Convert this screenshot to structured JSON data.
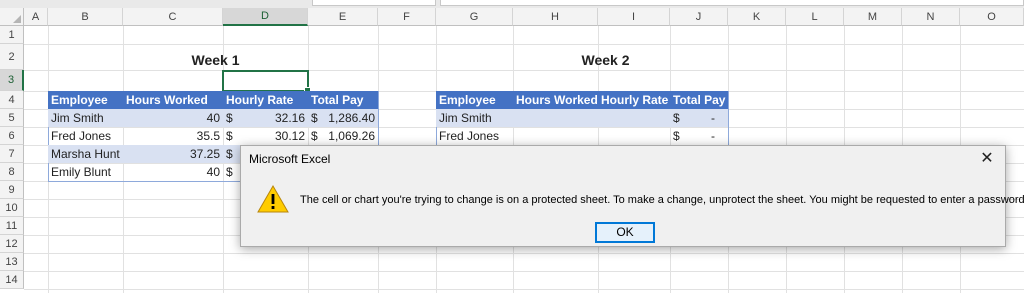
{
  "columns": [
    "A",
    "B",
    "C",
    "D",
    "E",
    "F",
    "G",
    "H",
    "I",
    "J",
    "K",
    "L",
    "M",
    "N",
    "O"
  ],
  "rows": [
    "1",
    "2",
    "3",
    "4",
    "5",
    "6",
    "7",
    "8",
    "9",
    "10",
    "11",
    "12",
    "13",
    "14"
  ],
  "selected_cell": "D3",
  "week1": {
    "title": "Week 1",
    "headers": [
      "Employee",
      "Hours Worked",
      "Hourly Rate",
      "Total Pay"
    ],
    "rows": [
      {
        "employee": "Jim Smith",
        "hours": "40",
        "rate_cur": "$",
        "rate": "32.16",
        "pay_cur": "$",
        "pay": "1,286.40"
      },
      {
        "employee": "Fred Jones",
        "hours": "35.5",
        "rate_cur": "$",
        "rate": "30.12",
        "pay_cur": "$",
        "pay": "1,069.26"
      },
      {
        "employee": "Marsha Hunt",
        "hours": "37.25",
        "rate_cur": "$",
        "rate": "",
        "pay_cur": "",
        "pay": ""
      },
      {
        "employee": "Emily Blunt",
        "hours": "40",
        "rate_cur": "$",
        "rate": "",
        "pay_cur": "",
        "pay": ""
      }
    ]
  },
  "week2": {
    "title": "Week 2",
    "headers": [
      "Employee",
      "Hours Worked",
      "Hourly Rate",
      "Total Pay"
    ],
    "rows": [
      {
        "employee": "Jim Smith",
        "pay_cur": "$",
        "pay": "-"
      },
      {
        "employee": "Fred Jones",
        "pay_cur": "$",
        "pay": "-"
      }
    ]
  },
  "dialog": {
    "title": "Microsoft Excel",
    "message": "The cell or chart you're trying to change is on a protected sheet. To make a change, unprotect the sheet. You might be requested to enter a password.",
    "ok_label": "OK",
    "close_glyph": "✕",
    "icon": "warning-icon"
  },
  "colors": {
    "table_header": "#4472c4",
    "band": "#d9e1f2",
    "selection": "#217346"
  }
}
